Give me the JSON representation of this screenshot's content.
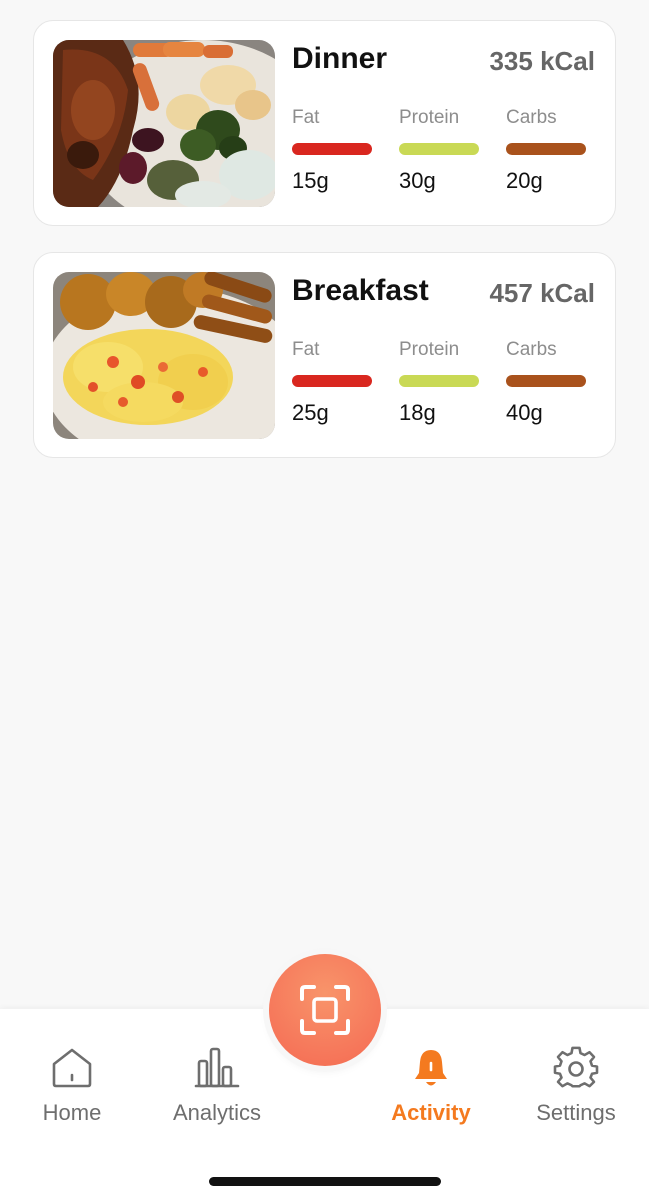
{
  "meals": [
    {
      "title": "Dinner",
      "kcal": "335 kCal",
      "photo": "roast-chicken-vegetables-photo",
      "macros": [
        {
          "label": "Fat",
          "value": "15g",
          "color": "#d9271f"
        },
        {
          "label": "Protein",
          "value": "30g",
          "color": "#c9d955"
        },
        {
          "label": "Carbs",
          "value": "20g",
          "color": "#a9521c"
        }
      ]
    },
    {
      "title": "Breakfast",
      "kcal": "457 kCal",
      "photo": "scrambled-eggs-plantain-photo",
      "macros": [
        {
          "label": "Fat",
          "value": "25g",
          "color": "#d9271f"
        },
        {
          "label": "Protein",
          "value": "18g",
          "color": "#c9d955"
        },
        {
          "label": "Carbs",
          "value": "40g",
          "color": "#a9521c"
        }
      ]
    }
  ],
  "nav": {
    "home": {
      "label": "Home",
      "icon": "home-icon"
    },
    "analytics": {
      "label": "Analytics",
      "icon": "bar-chart-icon"
    },
    "scan": {
      "icon": "scan-icon"
    },
    "activity": {
      "label": "Activity",
      "icon": "bell-icon",
      "active": true
    },
    "settings": {
      "label": "Settings",
      "icon": "gear-icon"
    }
  },
  "colors": {
    "accent": "#f47a1f",
    "scan_button": "#f6765a",
    "inactive_nav": "#6e6e6e"
  }
}
